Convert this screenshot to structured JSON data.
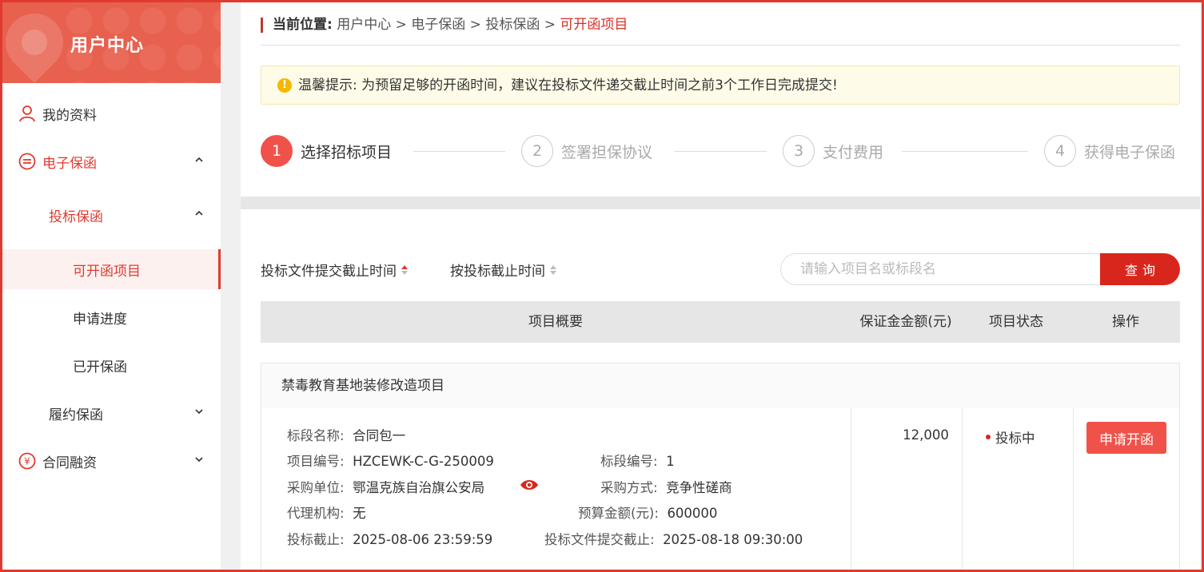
{
  "sidebar": {
    "title": "用户中心",
    "items": [
      {
        "label": "我的资料"
      },
      {
        "label": "电子保函"
      },
      {
        "label": "投标保函"
      },
      {
        "label": "可开函项目"
      },
      {
        "label": "申请进度"
      },
      {
        "label": "已开保函"
      },
      {
        "label": "履约保函"
      },
      {
        "label": "合同融资"
      }
    ]
  },
  "breadcrumb": {
    "lead": "当前位置:",
    "path": " 用户中心 > 电子保函 > 投标保函 > ",
    "current": "可开函项目"
  },
  "notice": {
    "text": "温馨提示: 为预留足够的开函时间，建议在投标文件递交截止时间之前3个工作日完成提交!"
  },
  "steps": [
    {
      "num": "1",
      "label": "选择招标项目"
    },
    {
      "num": "2",
      "label": "签署担保协议"
    },
    {
      "num": "3",
      "label": "支付费用"
    },
    {
      "num": "4",
      "label": "获得电子保函"
    }
  ],
  "filters": {
    "sort1": "投标文件提交截止时间",
    "sort2": "按投标截止时间",
    "search_placeholder": "请输入项目名或标段名",
    "search_button": "查询"
  },
  "table": {
    "headers": [
      "项目概要",
      "保证金金额(元)",
      "项目状态",
      "操作"
    ],
    "row": {
      "project_name": "禁毒教育基地装修改造项目",
      "fields": {
        "section_name_k": "标段名称:",
        "section_name_v": "合同包一",
        "project_no_k": "项目编号:",
        "project_no_v": "HZCEWK-C-G-250009",
        "section_no_k": "标段编号:",
        "section_no_v": "1",
        "buyer_k": "采购单位:",
        "buyer_v": "鄂温克族自治旗公安局",
        "method_k": "采购方式:",
        "method_v": "竞争性磋商",
        "agency_k": "代理机构:",
        "agency_v": "无",
        "budget_k": "预算金额(元):",
        "budget_v": "600000",
        "bid_deadline_k": "投标截止:",
        "bid_deadline_v": "2025-08-06 23:59:59",
        "doc_deadline_k": "投标文件提交截止:",
        "doc_deadline_v": "2025-08-18 09:30:00"
      },
      "amount": "12,000",
      "status": "投标中",
      "action": "申请开函"
    }
  },
  "colors": {
    "accent": "#e03a2f",
    "header_bg": "#e8604e",
    "button": "#f0524a"
  }
}
